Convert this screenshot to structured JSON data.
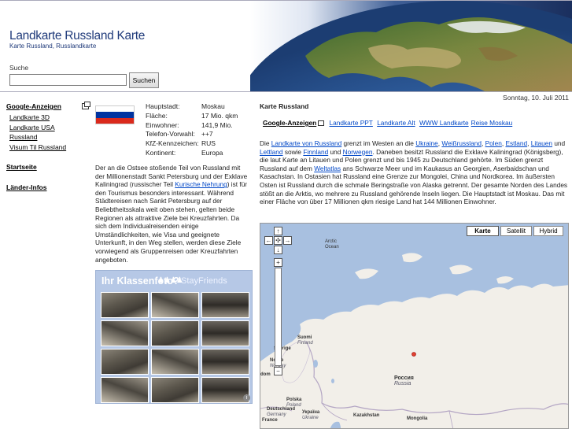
{
  "header": {
    "title": "Landkarte Russland Karte",
    "subtitle": "Karte Russland, Russlandkarte",
    "search_label": "Suche",
    "search_value": "",
    "search_button": "Suchen"
  },
  "date": "Sonntag, 10. Juli 2011",
  "leftnav": {
    "ads_heading": "Google-Anzeigen",
    "links": [
      "Landkarte 3D",
      "Landkarte USA",
      "Russland",
      "Visum Til Russland"
    ],
    "startseite": "Startseite",
    "laender": "Länder-Infos"
  },
  "facts": [
    {
      "k": "Hauptstadt:",
      "v": "Moskau"
    },
    {
      "k": "Fläche:",
      "v": "17 Mio. qkm"
    },
    {
      "k": "Einwohner:",
      "v": "141,9 Mio."
    },
    {
      "k": "Telefon-Vorwahl:",
      "v": "++7"
    },
    {
      "k": "KfZ-Kennzeichen:",
      "v": "RUS"
    },
    {
      "k": "Kontinent:",
      "v": "Europa"
    }
  ],
  "flag_colors": [
    "#ffffff",
    "#0033a0",
    "#da291c"
  ],
  "desc": {
    "p1": "Der an die Ostsee stoßende Teil von Russland mit der Millionenstadt Sankt Petersburg und der Exklave Kaliningrad (russischer Teil ",
    "link": "Kurische Nehrung",
    "p2": ") ist für den Tourismus besonders interessant. Während Städtereisen nach Sankt Petersburg auf der Beliebtheitsskala weit oben stehen, gelten beide Regionen als attraktive Ziele bei Kreuzfahrten. Da sich dem Individualreisenden einige Umständlichkeiten, wie Visa und geeignete Unterkunft, in den Weg stellen, werden diese Ziele vorwiegend als Gruppenreisen oder Kreuzfahrten angeboten."
  },
  "ad": {
    "title": "Ihr Klassenfoto?",
    "brand": "StayFriends",
    "info": "i"
  },
  "main": {
    "title": "Karte Russland",
    "ads_heading": "Google-Anzeigen",
    "ad_links": [
      "Landkarte PPT",
      "Landkarte Alt",
      "WWW Landkarte",
      "Reise Moskau"
    ],
    "t1": "Die ",
    "l1": "Landkarte von Russland",
    "t2": " grenzt im Westen an die ",
    "l2": "Ukraine",
    "t3": ", ",
    "l3": "Weißrussland",
    "t4": ", ",
    "l4": "Polen",
    "t5": ", ",
    "l5": "Estland",
    "t6": ", ",
    "l6": "Litauen",
    "t7": " und ",
    "l7": "Lettland",
    "t8": " sowie ",
    "l8": "Finnland",
    "t9": " und ",
    "l9": "Norwegen",
    "t10": ". Daneben besitzt Russland die Exklave Kaliningrad (Königsberg), die laut Karte an Litauen und Polen grenzt und bis 1945 zu Deutschland gehörte. Im Süden grenzt Russland auf dem ",
    "l10": "Weltatlas",
    "t11": " ans Schwarze Meer und im Kaukasus an Georgien, Aserbaidschan und Kasachstan. In Ostasien hat Russland eine Grenze zur Mongolei, China und Nordkorea. Im äußersten Osten ist Russland durch die schmale Beringstraße von Alaska getrennt. Der gesamte Norden des Landes stößt an die Arktis, wo mehrere zu Russland gehörende Inseln liegen. Die Hauptstadt ist Moskau. Das mit einer Fläche von über 17 Millionen qkm riesige Land hat 144 Millionen Einwohner."
  },
  "map": {
    "buttons": [
      "Karte",
      "Satellit",
      "Hybrid"
    ],
    "pan": {
      "up": "↑",
      "left": "←",
      "center": "✣",
      "right": "→",
      "down": "↓"
    },
    "zoom_in": "+",
    "zoom_out": "−",
    "labels": {
      "arctic": "Arctic",
      "ocean": "Ocean",
      "suomi": "Suomi",
      "finland": "Finland",
      "sverige": "Sverige",
      "norge": "Norge",
      "norway": "Norway",
      "polska": "Polska",
      "poland": "Poland",
      "deutschland": "Deutschland",
      "germany": "Germany",
      "ukraina": "Україна",
      "ukraine": "Ukraine",
      "france": "France",
      "kazakhstan": "Kazakhstan",
      "mongolia": "Mongolia",
      "rossiya": "Россия",
      "russia": "Russia",
      "dom": "dom"
    },
    "colors": {
      "water": "#a8c0e0",
      "land": "#f2efe9",
      "border": "#b4a6c4"
    }
  }
}
